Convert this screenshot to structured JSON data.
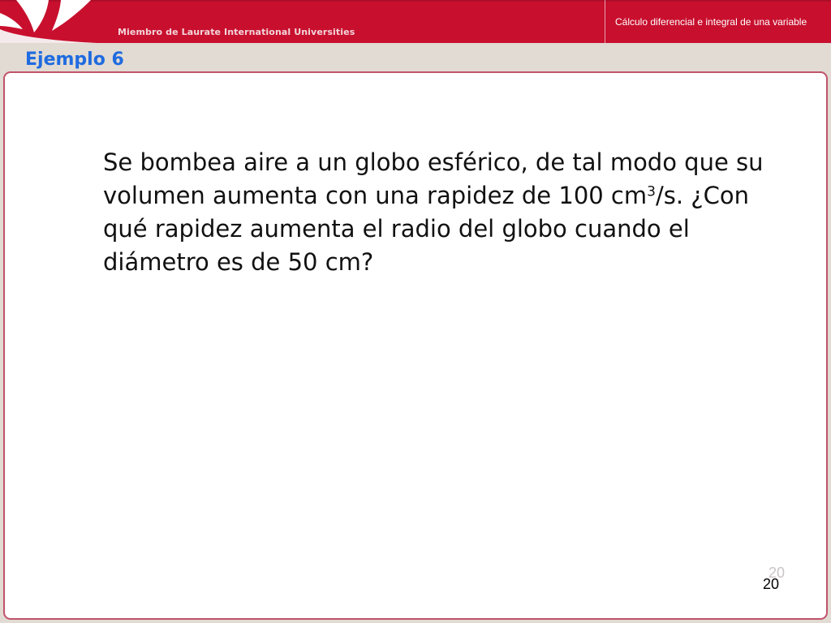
{
  "header": {
    "membership_text": "Miembro de Laurate International Universities",
    "course_title": "Cálculo diferencial e integral de una variable"
  },
  "slide": {
    "title": "Ejemplo 6",
    "question_part1": "Se bombea aire a un globo esférico, de tal modo que su volumen aumenta con una rapidez de 100 cm",
    "question_superscript": "3",
    "question_part2": "/s.   ¿Con qué rapidez aumenta el radio del globo cuando el diámetro es de 50 cm?",
    "page_number_ghost": "20",
    "page_number": "20"
  },
  "colors": {
    "brand_red": "#c8102e",
    "title_blue": "#1f6be0",
    "frame_border": "#c1536a",
    "background": "#e1dbd3"
  }
}
